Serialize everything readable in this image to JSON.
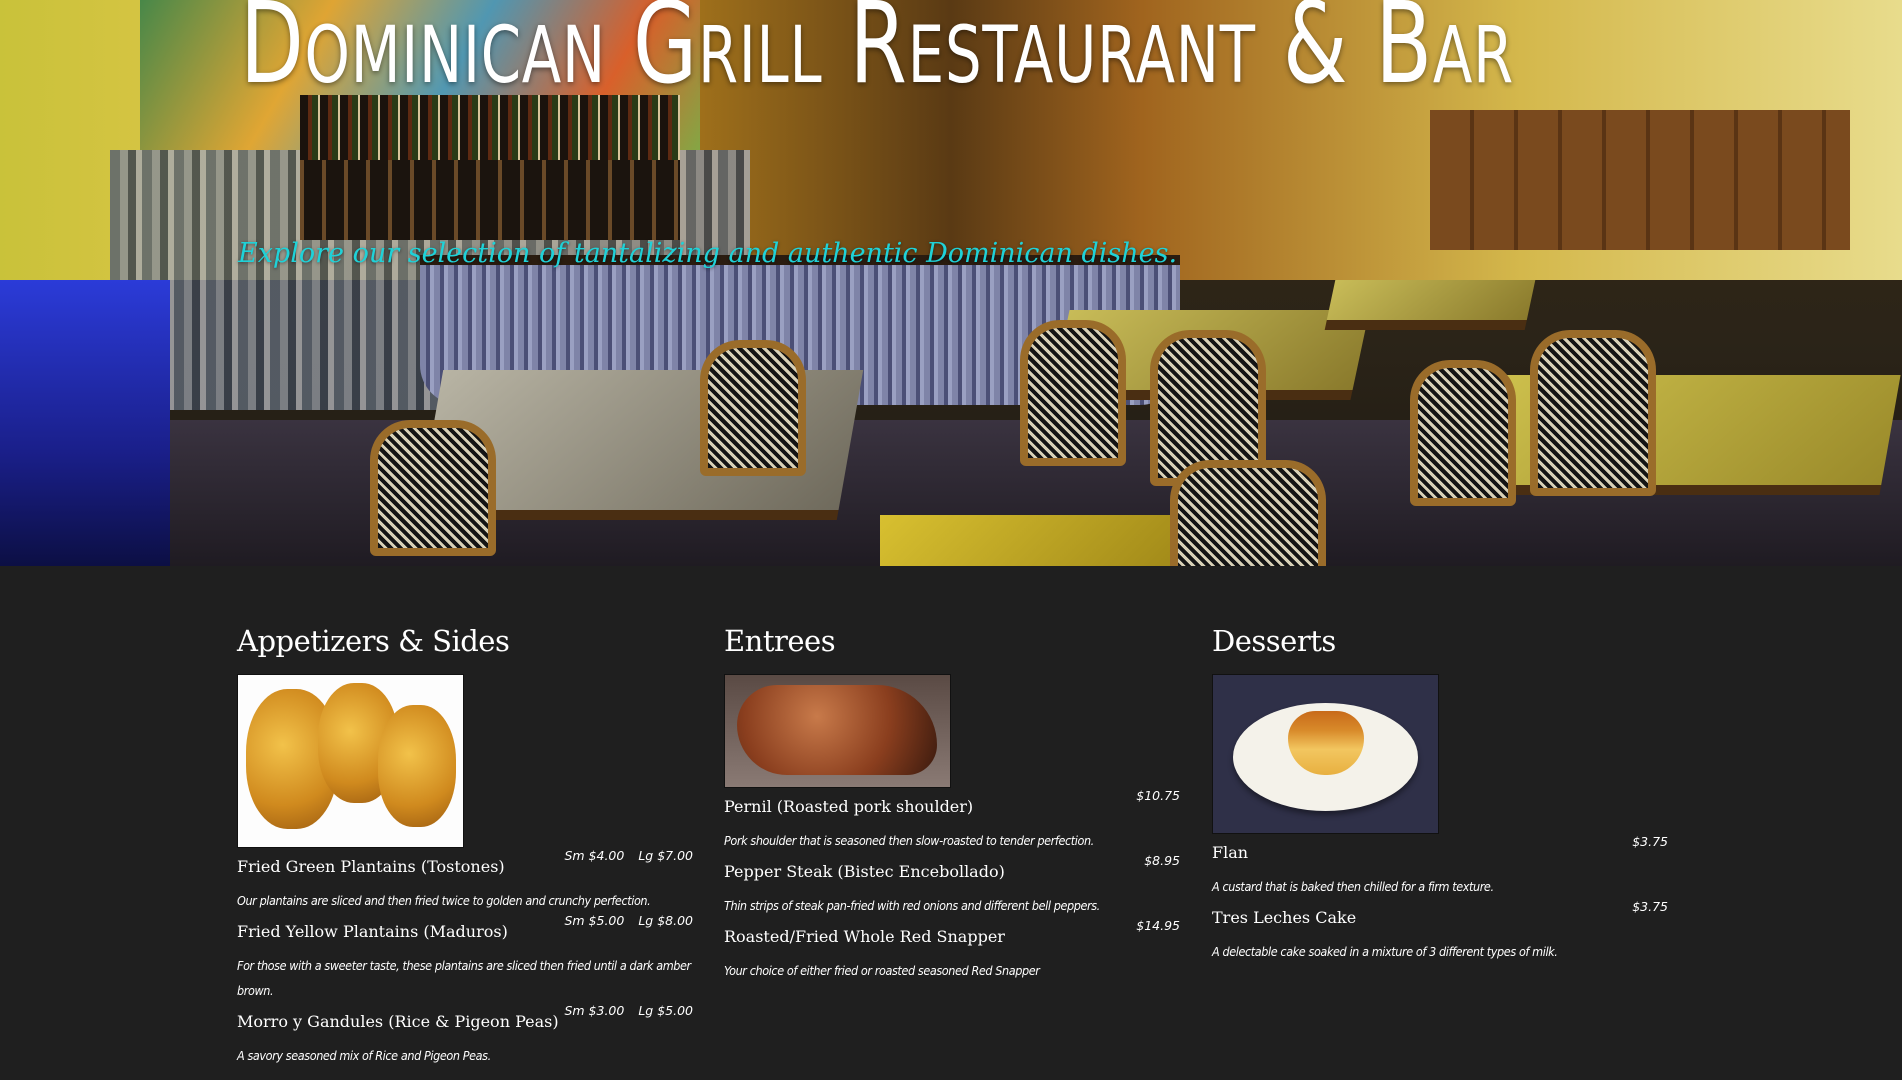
{
  "hero": {
    "title": "Dominican Grill Restaurant & Bar",
    "subtitle": "Explore our selection of tantalizing and authentic Dominican dishes."
  },
  "colors": {
    "subtitle": "#1fd2d8",
    "menu_background": "#1f1f1f",
    "text": "#ffffff"
  },
  "menu": {
    "appetizers": {
      "heading": "Appetizers & Sides",
      "items": [
        {
          "name": "Fried Green Plantains (Tostones)",
          "price_sm": "Sm $4.00",
          "price_lg": "Lg $7.00",
          "description": "Our plantains are sliced and then fried twice to golden and crunchy perfection."
        },
        {
          "name": "Fried Yellow Plantains (Maduros)",
          "price_sm": "Sm $5.00",
          "price_lg": "Lg $8.00",
          "description": "For those with a sweeter taste, these plantains are sliced then fried until a dark amber brown."
        },
        {
          "name": "Morro y Gandules (Rice & Pigeon Peas)",
          "price_sm": "Sm $3.00",
          "price_lg": "Lg $5.00",
          "description": "A savory seasoned mix of Rice and Pigeon Peas."
        }
      ]
    },
    "entrees": {
      "heading": "Entrees",
      "items": [
        {
          "name": "Pernil (Roasted pork shoulder)",
          "price": "$10.75",
          "description": "Pork shoulder that is seasoned then slow-roasted to tender perfection."
        },
        {
          "name": "Pepper Steak (Bistec Encebollado)",
          "price": "$8.95",
          "description": "Thin strips of steak pan-fried with red onions and different bell peppers."
        },
        {
          "name": "Roasted/Fried Whole Red Snapper",
          "price": "$14.95",
          "description": "Your choice of either fried or roasted seasoned Red Snapper"
        }
      ]
    },
    "desserts": {
      "heading": "Desserts",
      "items": [
        {
          "name": "Flan",
          "price": "$3.75",
          "description": "A custard that is baked then chilled for a firm texture."
        },
        {
          "name": "Tres Leches Cake",
          "price": "$3.75",
          "description": "A delectable cake soaked in a mixture of 3 different types of milk."
        }
      ]
    }
  }
}
